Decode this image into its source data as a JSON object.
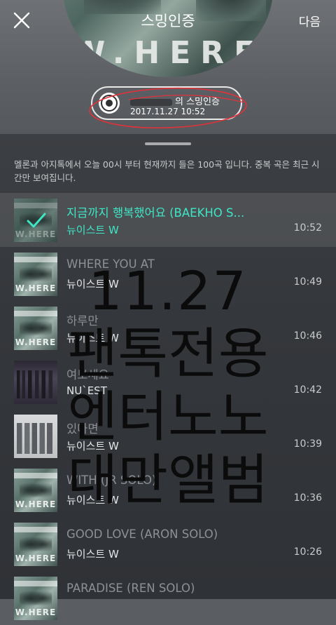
{
  "header": {
    "title": "스밍인증",
    "next_label": "다음",
    "album_wordmark": "W.HERE"
  },
  "certificate": {
    "label": "의 스밍인증",
    "datetime": "2017.11.27 10:52"
  },
  "info_text": "멜론과 아지톡에서 오늘 00시 부터 현재까지 들은 100곡 입니다. 중복 곡은 최근 시간만 보여집니다.",
  "tracks": [
    {
      "title": "지금까지 행복했어요 (BAEKHO S...",
      "artist": "뉴이스트 W",
      "time": "10:52",
      "cover": "W.HERE"
    },
    {
      "title": "WHERE YOU AT",
      "artist": "뉴이스트 W",
      "time": "10:49",
      "cover": "W.HERE"
    },
    {
      "title": "하루만",
      "artist": "뉴이스트 W",
      "time": "10:46",
      "cover": "W.HERE"
    },
    {
      "title": "여보세요",
      "artist": "NU`EST",
      "time": "10:42",
      "cover": ""
    },
    {
      "title": "있다면",
      "artist": "뉴이스트 W",
      "time": "10:39",
      "cover": ""
    },
    {
      "title": "WITH (JR SOLO)",
      "artist": "뉴이스트 W",
      "time": "10:36",
      "cover": "W.HERE"
    },
    {
      "title": "GOOD LOVE (ARON SOLO)",
      "artist": "뉴이스트 W",
      "time": "10:26",
      "cover": "W.HERE"
    },
    {
      "title": "PARADISE (REN SOLO)",
      "artist": "",
      "time": "",
      "cover": "W.HERE"
    }
  ],
  "overlay": {
    "date": "11.27",
    "line2": "팬톡전용",
    "line3": "엔터노노",
    "line4": "대만앨범"
  },
  "colors": {
    "accent": "#3ee6c6",
    "annotation": "#e0323a",
    "sheet_bg": "#36393d"
  },
  "icons": {
    "close": "close-icon",
    "disc": "disc-icon",
    "check": "check-icon"
  }
}
